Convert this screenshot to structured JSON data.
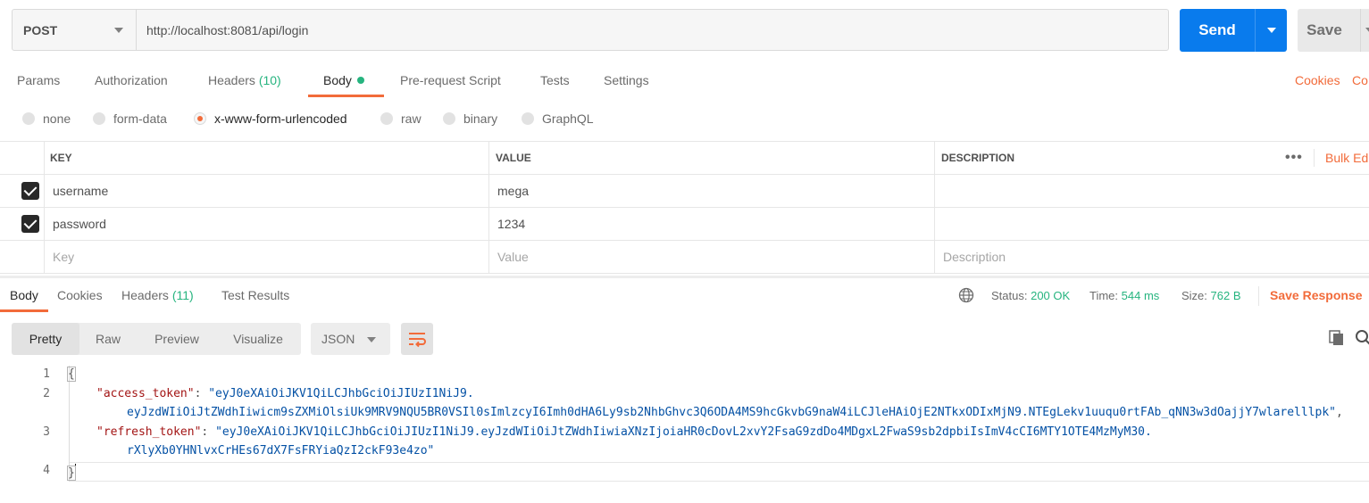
{
  "request": {
    "method": "POST",
    "url": "http://localhost:8081/api/login",
    "send_label": "Send",
    "save_label": "Save"
  },
  "request_tabs": [
    {
      "label": "Params"
    },
    {
      "label": "Authorization"
    },
    {
      "label": "Headers",
      "count": "(10)"
    },
    {
      "label": "Body"
    },
    {
      "label": "Pre-request Script"
    },
    {
      "label": "Tests"
    },
    {
      "label": "Settings"
    }
  ],
  "cookies_link": "Cookies",
  "code_link": "Co",
  "body_types": [
    {
      "label": "none"
    },
    {
      "label": "form-data"
    },
    {
      "label": "x-www-form-urlencoded"
    },
    {
      "label": "raw"
    },
    {
      "label": "binary"
    },
    {
      "label": "GraphQL"
    }
  ],
  "params_table": {
    "headers": {
      "key": "KEY",
      "value": "VALUE",
      "description": "DESCRIPTION"
    },
    "bulk_edit": "Bulk Ed",
    "rows": [
      {
        "key": "username",
        "value": "mega",
        "description": ""
      },
      {
        "key": "password",
        "value": "1234",
        "description": ""
      }
    ],
    "placeholders": {
      "key": "Key",
      "value": "Value",
      "description": "Description"
    }
  },
  "response_tabs": [
    {
      "label": "Body"
    },
    {
      "label": "Cookies"
    },
    {
      "label": "Headers",
      "count": "(11)"
    },
    {
      "label": "Test Results"
    }
  ],
  "status": {
    "status_label": "Status:",
    "status_value": "200 OK",
    "time_label": "Time:",
    "time_value": "544 ms",
    "size_label": "Size:",
    "size_value": "762 B",
    "save_response": "Save Response"
  },
  "view_modes": [
    {
      "label": "Pretty"
    },
    {
      "label": "Raw"
    },
    {
      "label": "Preview"
    },
    {
      "label": "Visualize"
    }
  ],
  "format": "JSON",
  "code": {
    "line_numbers": [
      "1",
      "2",
      "3",
      "4"
    ],
    "open_brace": "{",
    "close_brace": "}",
    "access_key": "\"access_token\"",
    "access_val_1": "\"eyJ0eXAiOiJKV1QiLCJhbGciOiJIUzI1NiJ9.",
    "access_val_2": "eyJzdWIiOiJtZWdhIiwicm9sZXMiOlsiUk9MRV9NQU5BR0VSIl0sImlzcyI6Imh0dHA6Ly9sb2NhbGhvc3Q6ODA4MS9hcGkvbG9naW4iLCJleHAiOjE2NTkxODIxMjN9.NTEgLekv1uuqu0rtFAb_qNN3w3dOajjY7wlarelllpk\"",
    "refresh_key": "\"refresh_token\"",
    "refresh_val_1": "\"eyJ0eXAiOiJKV1QiLCJhbGciOiJIUzI1NiJ9.eyJzdWIiOiJtZWdhIiwiaXNzIjoiaHR0cDovL2xvY2FsaG9zdDo4MDgxL2FwaS9sb2dpbiIsImV4cCI6MTY1OTE4MzMyM30.",
    "refresh_val_2": "rXlyXb0YHNlvxCrHEs67dX7FsFRYiaQzI2ckF93e4zo\""
  }
}
